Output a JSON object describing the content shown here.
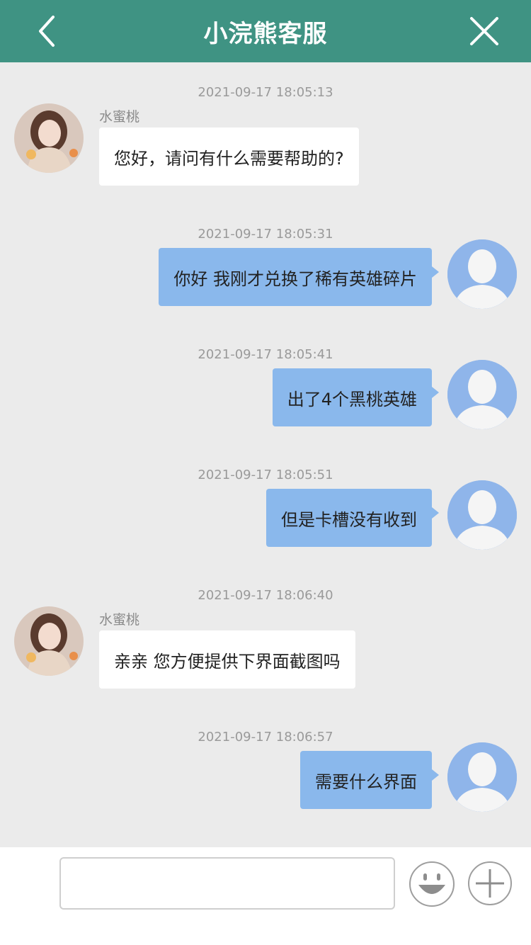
{
  "header": {
    "title": "小浣熊客服"
  },
  "colors": {
    "header_bg": "#3f9383",
    "chat_bg": "#ebebeb",
    "bubble_user": "#8ab8ec",
    "bubble_agent": "#ffffff",
    "user_avatar_bg": "#8fb5ea"
  },
  "messages": [
    {
      "time": "2021-09-17 18:05:13",
      "side": "agent",
      "sender": "水蜜桃",
      "text": "您好，请问有什么需要帮助的?"
    },
    {
      "time": "2021-09-17 18:05:31",
      "side": "user",
      "text": "你好 我刚才兑换了稀有英雄碎片"
    },
    {
      "time": "2021-09-17 18:05:41",
      "side": "user",
      "text": "出了4个黑桃英雄"
    },
    {
      "time": "2021-09-17 18:05:51",
      "side": "user",
      "text": "但是卡槽没有收到"
    },
    {
      "time": "2021-09-17 18:06:40",
      "side": "agent",
      "sender": "水蜜桃",
      "text": "亲亲 您方便提供下界面截图吗"
    },
    {
      "time": "2021-09-17 18:06:57",
      "side": "user",
      "text": "需要什么界面"
    }
  ],
  "input": {
    "value": "",
    "placeholder": ""
  },
  "icons": {
    "back": "chevron-left-icon",
    "close": "close-icon",
    "emoji": "smiley-icon",
    "plus": "plus-icon",
    "agent_avatar": "agent-avatar-photo",
    "user_avatar": "default-user-avatar"
  }
}
